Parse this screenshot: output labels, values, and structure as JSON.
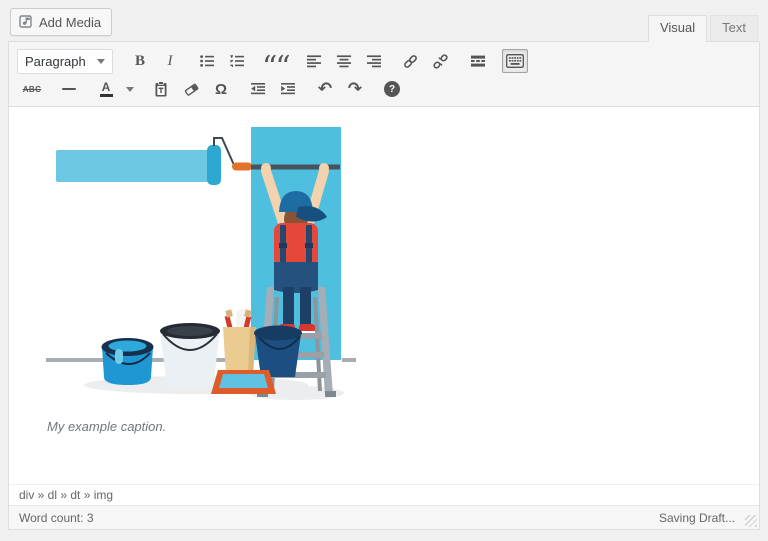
{
  "header": {
    "add_media_label": "Add Media",
    "tabs": {
      "visual": "Visual",
      "text": "Text"
    }
  },
  "toolbar": {
    "paragraph_dropdown_value": "Paragraph",
    "bold_glyph": "B",
    "italic_glyph": "I",
    "blockquote_glyph": "““",
    "strikethrough_glyph": "ABC",
    "textcolor_letter": "A",
    "special_char_glyph": "Ω",
    "undo_glyph": "↶",
    "redo_glyph": "↷",
    "help_glyph": "?",
    "icon_names": [
      "add-media-icon",
      "bold",
      "italic",
      "bulleted-list-icon",
      "numbered-list-icon",
      "blockquote-icon",
      "align-left-icon",
      "align-center-icon",
      "align-right-icon",
      "link-icon",
      "unlink-icon",
      "read-more-icon",
      "toolbar-toggle-keyboard-icon",
      "strikethrough-icon",
      "horizontal-rule-icon",
      "text-color-icon",
      "paste-as-text-icon",
      "clear-formatting-icon",
      "special-character-icon",
      "outdent-icon",
      "indent-icon",
      "undo-icon",
      "redo-icon",
      "help-icon"
    ],
    "toolbar_toggle_active": true
  },
  "content": {
    "caption": "My example caption.",
    "image_alt": "painter-on-ladder-illustration"
  },
  "footer": {
    "element_path": "div » dl » dt » img",
    "word_count_label": "Word count:",
    "word_count_value": "3",
    "saving_status": "Saving Draft..."
  },
  "colors": {
    "page_bg": "#f0f0f1",
    "toolbar_bg": "#f5f5f5",
    "border": "#dedede",
    "icon": "#555555",
    "wall_blue": "#4fbfdf",
    "stripe_blue": "#6cc7e2",
    "roller_blue": "#2ea8d2",
    "handle_orange": "#e0722b",
    "shirt_red": "#e5473b",
    "overalls_navy": "#24517e",
    "cap_blue": "#1d6ca4",
    "ladder_grey": "#a6aeb5",
    "tray_orange": "#de5b2a",
    "bucket_navy": "#1c4e82",
    "can_blue": "#1e97d2"
  }
}
